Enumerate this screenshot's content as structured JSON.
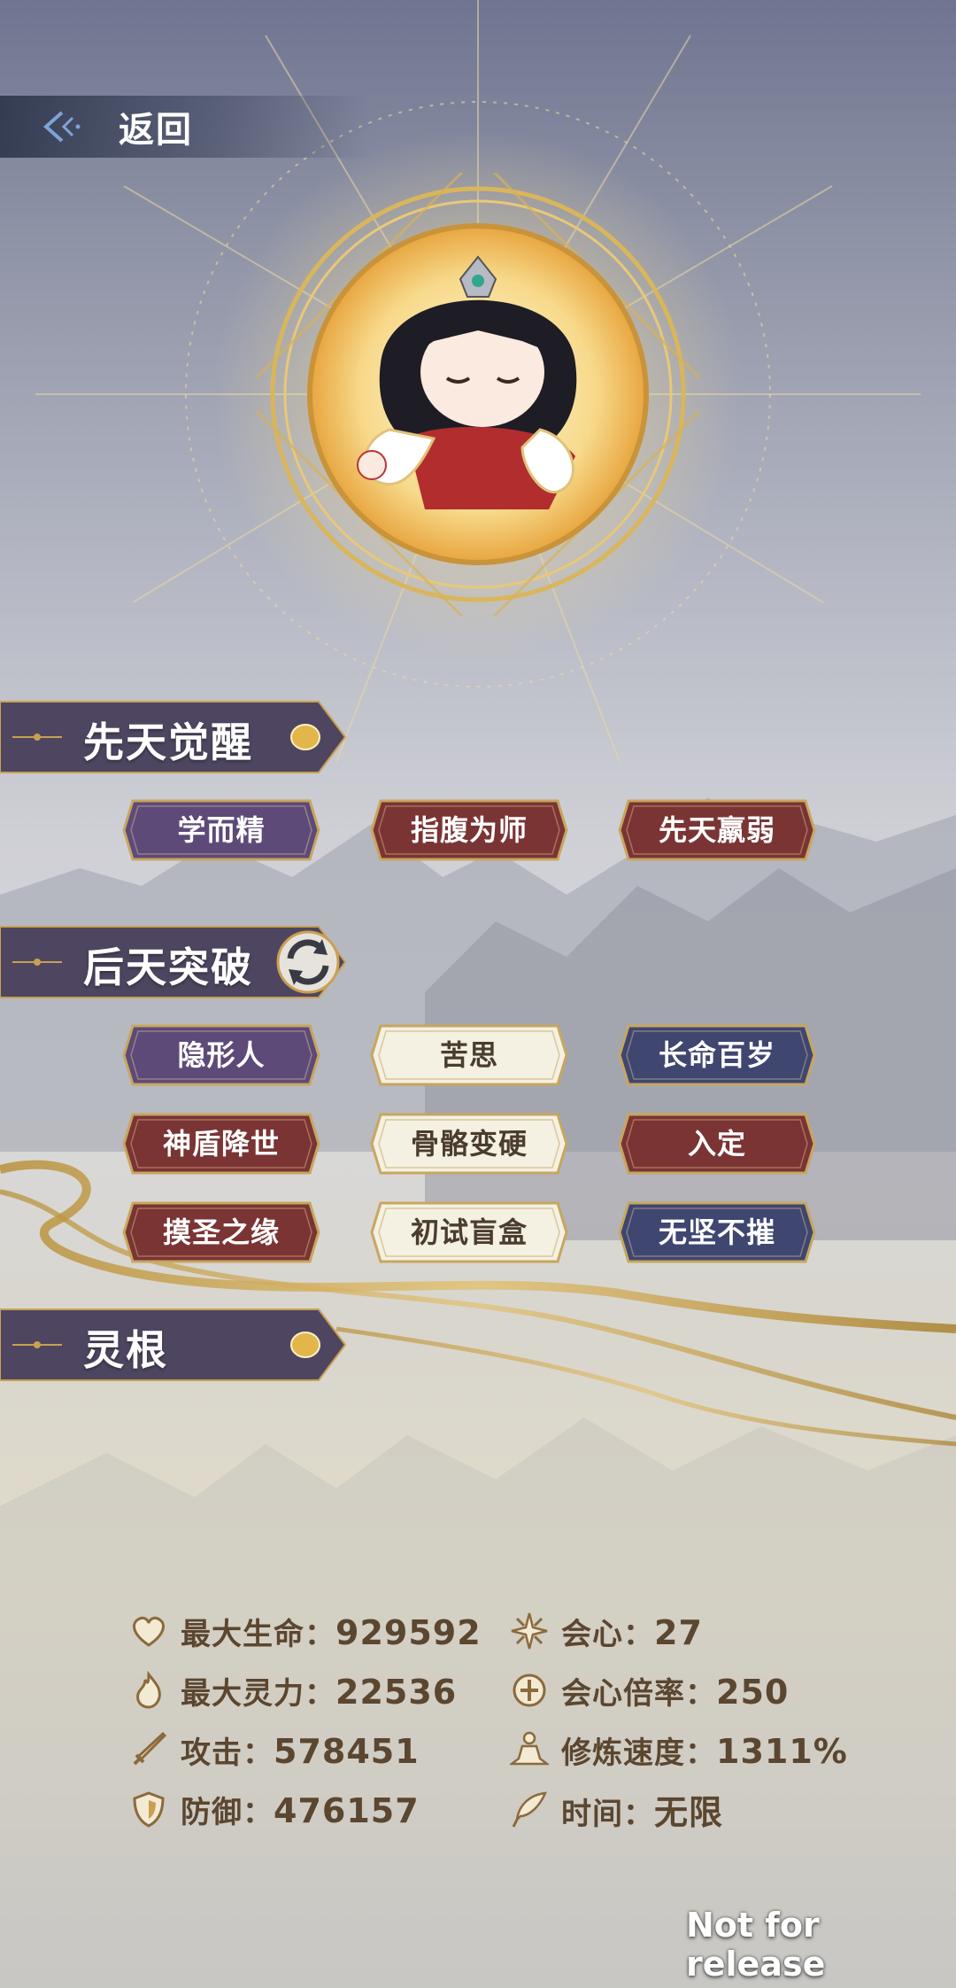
{
  "header": {
    "back_label": "返回"
  },
  "sections": {
    "innate": {
      "title": "先天觉醒"
    },
    "acquired": {
      "title": "后天突破"
    },
    "root": {
      "title": "灵根"
    }
  },
  "innate_tags": [
    {
      "label": "学而精",
      "color": "purple"
    },
    {
      "label": "指腹为师",
      "color": "red"
    },
    {
      "label": "先天羸弱",
      "color": "red"
    }
  ],
  "acquired_tags": [
    {
      "label": "隐形人",
      "color": "purple"
    },
    {
      "label": "苦思",
      "color": "cream"
    },
    {
      "label": "长命百岁",
      "color": "navy"
    },
    {
      "label": "神盾降世",
      "color": "red"
    },
    {
      "label": "骨骼变硬",
      "color": "cream"
    },
    {
      "label": "入定",
      "color": "red"
    },
    {
      "label": "摸圣之缘",
      "color": "red"
    },
    {
      "label": "初试盲盒",
      "color": "cream"
    },
    {
      "label": "无坚不摧",
      "color": "navy"
    }
  ],
  "stats": {
    "max_hp": {
      "label": "最大生命：",
      "value": "929592",
      "icon": "heart-icon"
    },
    "max_mana": {
      "label": "最大灵力：",
      "value": "22536",
      "icon": "flame-icon"
    },
    "attack": {
      "label": "攻击：",
      "value": "578451",
      "icon": "sword-icon"
    },
    "defense": {
      "label": "防御：",
      "value": "476157",
      "icon": "shield-icon"
    },
    "crit": {
      "label": "会心：",
      "value": "27",
      "icon": "crit-star-icon"
    },
    "crit_rate": {
      "label": "会心倍率：",
      "value": "250",
      "icon": "crit-multiplier-icon"
    },
    "cultivation_speed": {
      "label": "修炼速度：",
      "value": "1311%",
      "icon": "meditation-icon"
    },
    "time": {
      "label": "时间：",
      "value": "无限",
      "icon": "feather-icon"
    }
  },
  "watermark": "Not for release",
  "colors": {
    "tag_purple": "#5d4a78",
    "tag_red": "#7a3434",
    "tag_navy": "#3f4670",
    "tag_cream": "#f4f0e2",
    "gold": "#c9a052",
    "stat_text": "#5b4630"
  }
}
